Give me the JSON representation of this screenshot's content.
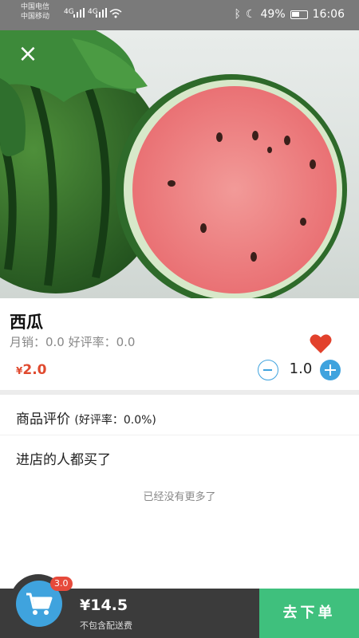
{
  "status_bar": {
    "carrier_1": "中国电信",
    "carrier_2": "中国移动",
    "network_1": "4G",
    "network_2": "4G",
    "battery": "49%",
    "time": "16:06"
  },
  "hero": {
    "close_icon": "close-icon",
    "image_subject": "watermelon"
  },
  "product": {
    "name": "西瓜",
    "sales": "月销：0.0 好评率：0.0",
    "price_symbol": "¥",
    "price": "2.0",
    "quantity": "1.0",
    "favorite_color": "#e2412c"
  },
  "sections": {
    "reviews_title": "商品评价",
    "reviews_rate": "(好评率：0.0%)",
    "also_bought": "进店的人都买了",
    "no_more": "已经没有更多了"
  },
  "cart": {
    "badge": "3.0",
    "total": "¥14.5",
    "delivery_note": "不包含配送费",
    "checkout_label": "去下单"
  },
  "colors": {
    "accent_blue": "#3fa3de",
    "checkout_green": "#3fc07d",
    "price_red": "#e04a2f"
  }
}
